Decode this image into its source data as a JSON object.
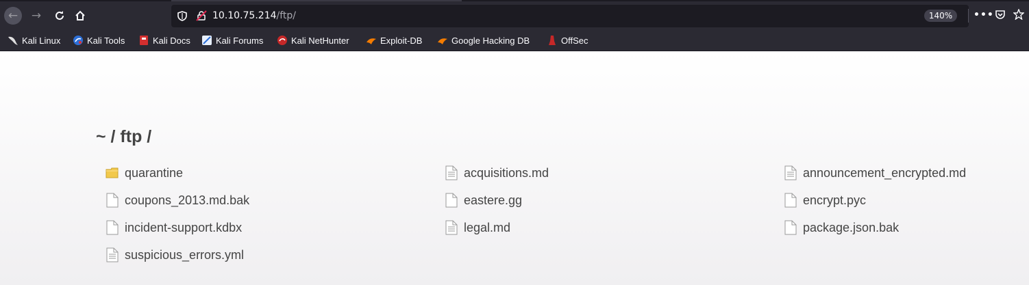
{
  "browser": {
    "url_host": "10.10.75.214",
    "url_path": "/ftp/",
    "zoom": "140%"
  },
  "bookmarks": [
    {
      "label": "Kali Linux",
      "icon": "kali-dragon-icon"
    },
    {
      "label": "Kali Tools",
      "icon": "kali-tools-icon"
    },
    {
      "label": "Kali Docs",
      "icon": "kali-docs-icon"
    },
    {
      "label": "Kali Forums",
      "icon": "kali-forums-icon"
    },
    {
      "label": "Kali NetHunter",
      "icon": "kali-nethunter-icon"
    },
    {
      "label": "Exploit-DB",
      "icon": "exploit-db-icon"
    },
    {
      "label": "Google Hacking DB",
      "icon": "ghdb-icon"
    },
    {
      "label": "OffSec",
      "icon": "offsec-icon"
    }
  ],
  "page": {
    "breadcrumb": "~ / ftp /"
  },
  "files": [
    {
      "name": "quarantine",
      "icon": "folder-icon"
    },
    {
      "name": "acquisitions.md",
      "icon": "text-file-icon"
    },
    {
      "name": "announcement_encrypted.md",
      "icon": "text-file-icon"
    },
    {
      "name": "coupons_2013.md.bak",
      "icon": "blank-file-icon"
    },
    {
      "name": "eastere.gg",
      "icon": "blank-file-icon"
    },
    {
      "name": "encrypt.pyc",
      "icon": "blank-file-icon"
    },
    {
      "name": "incident-support.kdbx",
      "icon": "blank-file-icon"
    },
    {
      "name": "legal.md",
      "icon": "text-file-icon"
    },
    {
      "name": "package.json.bak",
      "icon": "blank-file-icon"
    },
    {
      "name": "suspicious_errors.yml",
      "icon": "text-file-icon"
    }
  ],
  "colors": {
    "chrome_bg": "#2b2a33",
    "urlbar_bg": "#1c1b22",
    "page_text": "#444444",
    "folder_yellow": "#f2c94c"
  }
}
